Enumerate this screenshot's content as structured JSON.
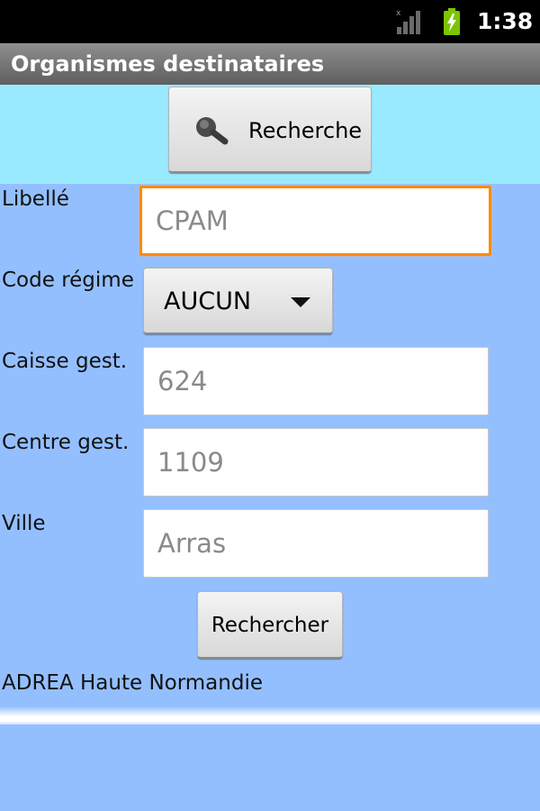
{
  "status_bar": {
    "time": "1:38",
    "signal_icon": "signal-bars-icon",
    "battery_icon": "battery-charging-icon",
    "battery_color": "#7cc400"
  },
  "title_bar": {
    "title": "Organismes destinataires"
  },
  "header": {
    "search_button": {
      "label": "Recherche",
      "icon": "magnifier-icon"
    }
  },
  "form": {
    "libelle": {
      "label": "Libellé",
      "value": "CPAM"
    },
    "code_regime": {
      "label": "Code régime",
      "selected": "AUCUN"
    },
    "caisse_gest": {
      "label": "Caisse gest.",
      "value": "624"
    },
    "centre_gest": {
      "label": "Centre gest.",
      "value": "1109"
    },
    "ville": {
      "label": "Ville",
      "value": "Arras"
    },
    "submit_label": "Rechercher"
  },
  "results": {
    "items": [
      "ADREA Haute Normandie"
    ]
  },
  "colors": {
    "title_bar": "#6e6e6e",
    "header_band": "#9aeaff",
    "form_background": "#94bfff",
    "focus_border": "#ff8a00"
  }
}
